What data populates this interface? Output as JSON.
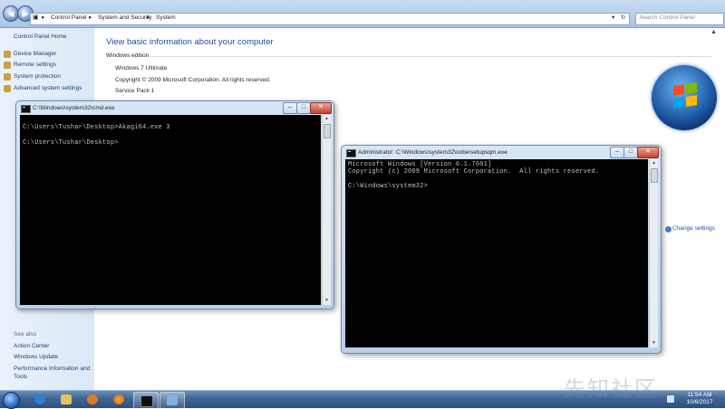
{
  "explorer": {
    "breadcrumbs": [
      "Control Panel",
      "System and Security",
      "System"
    ],
    "search_placeholder": "Search Control Panel",
    "sidebar": {
      "home": "Control Panel Home",
      "links": [
        "Device Manager",
        "Remote settings",
        "System protection",
        "Advanced system settings"
      ],
      "see_also_label": "See also",
      "see_also": [
        "Action Center",
        "Windows Update",
        "Performance Information and",
        "Tools"
      ]
    },
    "main": {
      "title": "View basic information about your computer",
      "section": "Windows edition",
      "edition": "Windows 7 Ultimate",
      "copyright": "Copyright © 2009 Microsoft Corporation.  All rights reserved.",
      "service_pack": "Service Pack 1",
      "change_settings": "Change settings"
    }
  },
  "console1": {
    "title": "C:\\Windows\\system32\\cmd.exe",
    "lines": [
      "C:\\Users\\Tushar\\Desktop>Akagi64.exe 3",
      "",
      "C:\\Users\\Tushar\\Desktop>"
    ]
  },
  "console2": {
    "title": "Administrator: C:\\Windows\\system32\\oobe\\setupsqm.exe",
    "lines": [
      "Microsoft Windows [Version 6.1.7601]",
      "Copyright (c) 2009 Microsoft Corporation.  All rights reserved.",
      "",
      "C:\\Windows\\system32>"
    ]
  },
  "taskbar": {
    "time": "11:54 AM",
    "date": "10/6/2017",
    "items": [
      "internet-explorer-icon",
      "folder-icon",
      "media-player-icon",
      "firefox-icon",
      "cmd-icon",
      "control-panel-icon"
    ]
  },
  "watermark": "先知社区",
  "colors": {
    "link": "#1e4e9e",
    "console_bg": "#000000",
    "console_text": "#c0c0c0",
    "taskbar": "#3f6493"
  }
}
